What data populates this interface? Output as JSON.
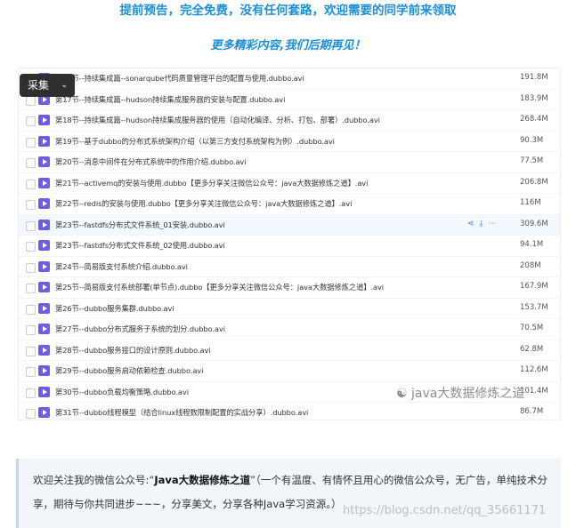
{
  "header": {
    "line1": "提前预告，完全免费，没有任何套路，欢迎需要的同学前来领取",
    "line2": "更多精彩内容,我们后期再见！"
  },
  "overlay": {
    "collect_label": "采集",
    "chevron": "⌄"
  },
  "row_actions": {
    "share_icon": "share-icon",
    "download_icon": "download-icon",
    "more_icon": "more-icon"
  },
  "files": [
    {
      "name": "第16节--持续集成篇--sonarqube代码质量管理平台的配置与使用.dubbo.avi",
      "size": "191.8M"
    },
    {
      "name": "第17节--持续集成篇--hudson持续集成服务器的安装与配置.dubbo.avi",
      "size": "183.9M"
    },
    {
      "name": "第18节--持续集成篇--hudson持续集成服务器的使用（自动化编译、分析、打包、部署）.dubbo.avi",
      "size": "268.4M"
    },
    {
      "name": "第19节--基于dubbo的分布式系统架构介绍（以第三方支付系统架构为例）.dubbo.avi",
      "size": "90.3M"
    },
    {
      "name": "第20节--消息中间件在分布式系统中的作用介绍.dubbo.avi",
      "size": "77.5M"
    },
    {
      "name": "第21节--activemq的安装与使用.dubbo【更多分享关注微信公众号：java大数据修炼之道】.avi",
      "size": "206.8M"
    },
    {
      "name": "第22节--redis的安装与使用.dubbo【更多分享关注微信公众号：java大数据修炼之道】.avi",
      "size": "116M"
    },
    {
      "name": "第23节--fastdfs分布式文件系统_01安装.dubbo.avi",
      "size": "309.6M"
    },
    {
      "name": "第23节--fastdfs分布式文件系统_02使用.dubbo.avi",
      "size": "94.1M"
    },
    {
      "name": "第24节--简易版支付系统介绍.dubbo.avi",
      "size": "208M"
    },
    {
      "name": "第25节--简易版支付系统部署(单节点).dubbo【更多分享关注微信公众号：java大数据修炼之道】.avi",
      "size": "167.9M"
    },
    {
      "name": "第26节--dubbo服务集群.dubbo.avi",
      "size": "153.7M"
    },
    {
      "name": "第27节--dubbo分布式服务子系统的划分.dubbo.avi",
      "size": "70.5M"
    },
    {
      "name": "第28节--dubbo服务接口的设计原则.dubbo.avi",
      "size": "62.8M"
    },
    {
      "name": "第29节--dubbo服务启动依赖检查.dubbo.avi",
      "size": "112.6M"
    },
    {
      "name": "第30节--dubbo负载均衡策略.dubbo.avi",
      "size": "101.4M"
    },
    {
      "name": "第31节--dubbo线程模型（结合linux线程数限制配置的实战分享）.dubbo.avi",
      "size": "86.7M"
    }
  ],
  "highlighted_index": 7,
  "watermark": "java大数据修炼之道",
  "footer": {
    "prefix": "欢迎关注我的微信公众号:“",
    "account": "Java大数据修炼之道",
    "suffix": "”（一个有温度、有情怀且用心的微信公众号，无广告，单纯技术分享，期待与你共同进步~~~，分享美文，分享各种Java学习资源。）",
    "blog_watermark": "https://blog.csdn.net/qq_35661171"
  },
  "colors": {
    "accent": "#1a8fd6",
    "file_icon": "#6d5ce8",
    "action": "#3b7fd8"
  }
}
